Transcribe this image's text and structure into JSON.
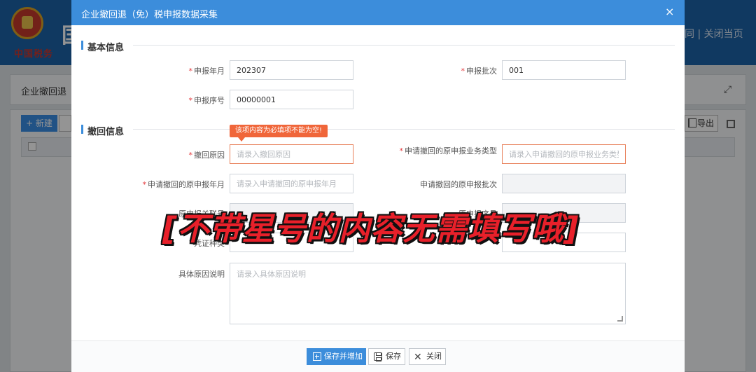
{
  "background": {
    "logo_text": "中国税务",
    "title_fragment": "国",
    "top_links": "同 | 关闭当页",
    "panel_title": "企业撤回退（",
    "new_button": "+ 新建",
    "export_button": "导出"
  },
  "modal": {
    "title": "企业撤回退（免）税申报数据采集",
    "close_icon": "×"
  },
  "basic_info": {
    "section_title": "基本信息",
    "required_mark": "*",
    "declare_month": {
      "label": "申报年月",
      "value": "202307"
    },
    "declare_batch": {
      "label": "申报批次",
      "value": "001"
    },
    "declare_seq": {
      "label": "申报序号",
      "value": "00000001"
    }
  },
  "withdraw_info": {
    "section_title": "撤回信息",
    "required_mark": "*",
    "error_tooltip": "该项内容为必填项不能为空!",
    "reason": {
      "label": "撤回原因",
      "placeholder": "请录入撤回原因"
    },
    "orig_business_type": {
      "label": "申请撤回的原申报业务类型",
      "placeholder": "请录入申请撤回的原申报业务类型"
    },
    "orig_month": {
      "label": "申请撤回的原申报年月",
      "placeholder": "请录入申请撤回的原申报年月"
    },
    "orig_batch": {
      "label": "申请撤回的原申报批次"
    },
    "orig_related_no": {
      "label": "原申报关联号"
    },
    "orig_seq": {
      "label": "原申报序号"
    },
    "voucher_type": {
      "label": "凭证种类"
    },
    "detail": {
      "label": "具体原因说明",
      "placeholder": "请录入具体原因说明"
    }
  },
  "footer": {
    "save_and_add": "保存并增加",
    "save": "保存",
    "close": "关闭"
  },
  "caption": "[不带星号的内容无需填写哦]",
  "colors": {
    "header_blue": "#3c8ddb",
    "required_red": "#e4393c",
    "tooltip_orange": "#f0663a",
    "caption_red": "#e8202a"
  }
}
